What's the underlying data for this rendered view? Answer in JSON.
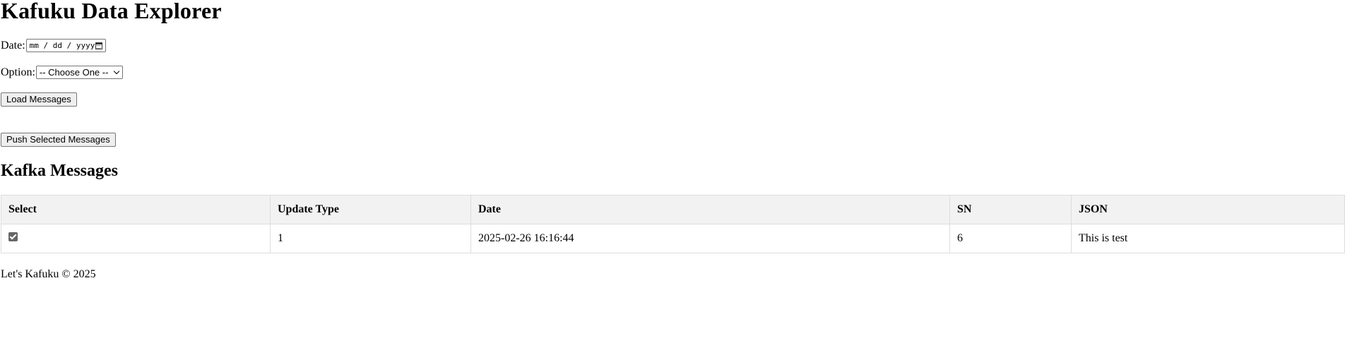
{
  "page": {
    "title": "Kafuku Data Explorer"
  },
  "form": {
    "date_label": "Date:",
    "date_placeholder": "mm / dd / yyyy",
    "option_label": "Option:",
    "option_selected": "-- Choose One --",
    "load_button": "Load Messages",
    "push_button": "Push Selected Messages"
  },
  "messages": {
    "heading": "Kafka Messages",
    "columns": [
      "Select",
      "Update Type",
      "Date",
      "SN",
      "JSON"
    ],
    "rows": [
      {
        "selected": true,
        "update_type": "1",
        "date": "2025-02-26 16:16:44",
        "sn": "6",
        "json": "This is test"
      }
    ]
  },
  "footer": {
    "text": "Let's Kafuku © 2025"
  },
  "icons": {
    "calendar": "calendar-icon",
    "dropdown": "chevron-down-icon",
    "check": "checkbox-checked"
  }
}
